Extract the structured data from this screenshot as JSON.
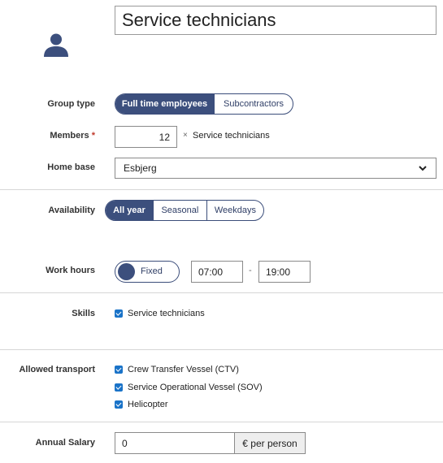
{
  "title": "Service technicians",
  "icons": {
    "avatar": "user-icon",
    "select_arrow": "chevron-down-icon"
  },
  "colors": {
    "accent": "#3c4f7d",
    "required": "#c0392b",
    "checkbox": "#1a73c8"
  },
  "group_type": {
    "label": "Group type",
    "options": [
      "Full time employees",
      "Subcontractors"
    ],
    "selected": "Full time employees"
  },
  "members": {
    "label": "Members",
    "required_mark": "*",
    "value": "12",
    "multiplier": "×",
    "unit": "Service technicians"
  },
  "home_base": {
    "label": "Home base",
    "value": "Esbjerg"
  },
  "availability": {
    "label": "Availability",
    "options": [
      "All year",
      "Seasonal",
      "Weekdays"
    ],
    "selected": "All year"
  },
  "work_hours": {
    "label": "Work hours",
    "toggle_label": "Fixed",
    "start": "07:00",
    "separator": "-",
    "end": "19:00"
  },
  "skills": {
    "label": "Skills",
    "items": [
      {
        "label": "Service technicians",
        "checked": true
      }
    ]
  },
  "allowed_transport": {
    "label": "Allowed transport",
    "items": [
      {
        "label": "Crew Transfer Vessel (CTV)",
        "checked": true
      },
      {
        "label": "Service Operational Vessel (SOV)",
        "checked": true
      },
      {
        "label": "Helicopter",
        "checked": true
      }
    ]
  },
  "annual_salary": {
    "label": "Annual Salary",
    "value": "0",
    "unit": "€ per person"
  }
}
